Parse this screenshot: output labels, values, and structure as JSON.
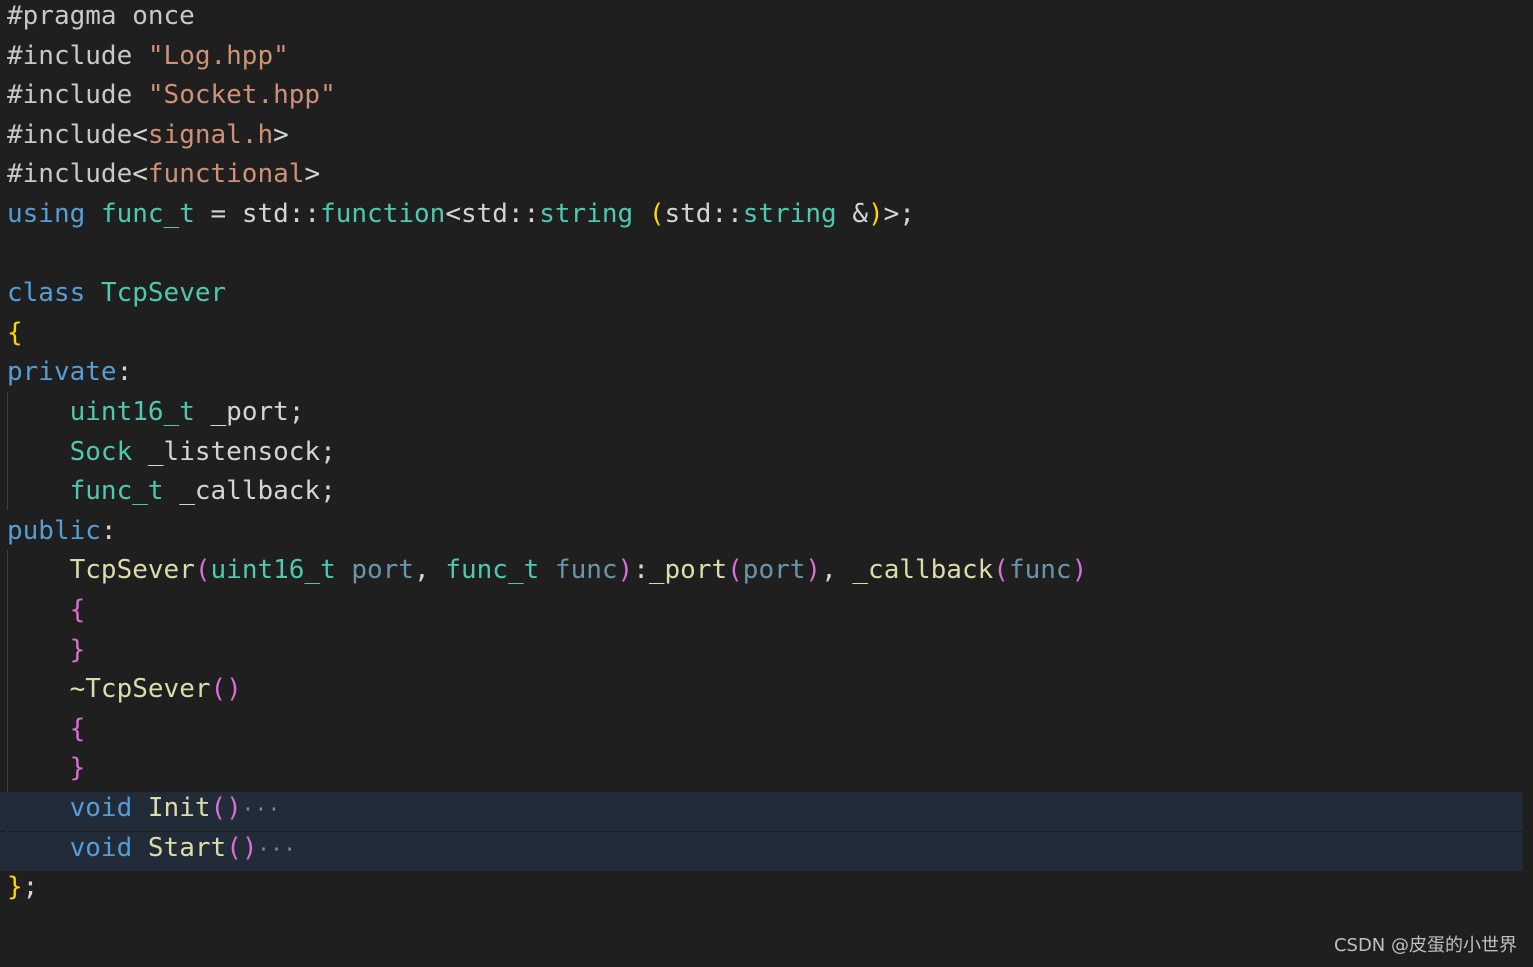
{
  "colors": {
    "background": "#1f1f1f",
    "folded_line_highlight": "#222c39",
    "keyword": "#569cd6",
    "type": "#4ec9b0",
    "function": "#dcdcaa",
    "string": "#ce9178",
    "parameter": "#9cdcfe",
    "bracket_level1": "#ffd700",
    "bracket_level2": "#da70d6",
    "plain": "#d4d4d4"
  },
  "code": {
    "language": "cpp",
    "lines": [
      {
        "folded": false,
        "tokens": [
          {
            "t": "#pragma once",
            "k": "prep"
          }
        ]
      },
      {
        "folded": false,
        "tokens": [
          {
            "t": "#include ",
            "k": "prep"
          },
          {
            "t": "\"Log.hpp\"",
            "k": "string"
          }
        ]
      },
      {
        "folded": false,
        "tokens": [
          {
            "t": "#include ",
            "k": "prep"
          },
          {
            "t": "\"Socket.hpp\"",
            "k": "string"
          }
        ]
      },
      {
        "folded": false,
        "tokens": [
          {
            "t": "#include",
            "k": "prep"
          },
          {
            "t": "<",
            "k": "op"
          },
          {
            "t": "signal.h",
            "k": "string"
          },
          {
            "t": ">",
            "k": "op"
          }
        ]
      },
      {
        "folded": false,
        "tokens": [
          {
            "t": "#include",
            "k": "prep"
          },
          {
            "t": "<",
            "k": "op"
          },
          {
            "t": "functional",
            "k": "string"
          },
          {
            "t": ">",
            "k": "op"
          }
        ]
      },
      {
        "folded": false,
        "tokens": [
          {
            "t": "using",
            "k": "keyword"
          },
          {
            "t": " ",
            "k": "plain"
          },
          {
            "t": "func_t",
            "k": "type"
          },
          {
            "t": " = std::",
            "k": "plain"
          },
          {
            "t": "function",
            "k": "type"
          },
          {
            "t": "<std::",
            "k": "plain"
          },
          {
            "t": "string",
            "k": "type"
          },
          {
            "t": " ",
            "k": "plain"
          },
          {
            "t": "(",
            "k": "brace1"
          },
          {
            "t": "std::",
            "k": "plain"
          },
          {
            "t": "string",
            "k": "type"
          },
          {
            "t": " &",
            "k": "plain"
          },
          {
            "t": ")",
            "k": "brace1"
          },
          {
            "t": ">;",
            "k": "plain"
          }
        ]
      },
      {
        "folded": false,
        "tokens": []
      },
      {
        "folded": false,
        "tokens": [
          {
            "t": "class",
            "k": "keyword"
          },
          {
            "t": " ",
            "k": "plain"
          },
          {
            "t": "TcpSever",
            "k": "type"
          }
        ]
      },
      {
        "folded": false,
        "tokens": [
          {
            "t": "{",
            "k": "brace1"
          }
        ]
      },
      {
        "folded": false,
        "tokens": [
          {
            "t": "private",
            "k": "keyword"
          },
          {
            "t": ":",
            "k": "plain"
          }
        ]
      },
      {
        "folded": false,
        "tokens": [
          {
            "t": "    ",
            "k": "plain"
          },
          {
            "t": "uint16_t",
            "k": "type"
          },
          {
            "t": " _port;",
            "k": "member"
          }
        ]
      },
      {
        "folded": false,
        "tokens": [
          {
            "t": "    ",
            "k": "plain"
          },
          {
            "t": "Sock",
            "k": "type"
          },
          {
            "t": " _listensock;",
            "k": "member"
          }
        ]
      },
      {
        "folded": false,
        "tokens": [
          {
            "t": "    ",
            "k": "plain"
          },
          {
            "t": "func_t",
            "k": "type"
          },
          {
            "t": " _callback;",
            "k": "member"
          }
        ]
      },
      {
        "folded": false,
        "tokens": [
          {
            "t": "public",
            "k": "keyword"
          },
          {
            "t": ":",
            "k": "plain"
          }
        ]
      },
      {
        "folded": false,
        "tokens": [
          {
            "t": "    ",
            "k": "plain"
          },
          {
            "t": "TcpSever",
            "k": "func"
          },
          {
            "t": "(",
            "k": "brace2"
          },
          {
            "t": "uint16_t",
            "k": "type"
          },
          {
            "t": " ",
            "k": "plain"
          },
          {
            "t": "port",
            "k": "param"
          },
          {
            "t": ", ",
            "k": "plain"
          },
          {
            "t": "func_t",
            "k": "type"
          },
          {
            "t": " ",
            "k": "plain"
          },
          {
            "t": "func",
            "k": "param"
          },
          {
            "t": ")",
            "k": "brace2"
          },
          {
            "t": ":",
            "k": "plain"
          },
          {
            "t": "_port",
            "k": "func"
          },
          {
            "t": "(",
            "k": "brace2"
          },
          {
            "t": "port",
            "k": "param"
          },
          {
            "t": ")",
            "k": "brace2"
          },
          {
            "t": ", ",
            "k": "plain"
          },
          {
            "t": "_callback",
            "k": "func"
          },
          {
            "t": "(",
            "k": "brace2"
          },
          {
            "t": "func",
            "k": "param"
          },
          {
            "t": ")",
            "k": "brace2"
          }
        ]
      },
      {
        "folded": false,
        "tokens": [
          {
            "t": "    ",
            "k": "plain"
          },
          {
            "t": "{",
            "k": "brace2"
          }
        ]
      },
      {
        "folded": false,
        "tokens": [
          {
            "t": "    ",
            "k": "plain"
          },
          {
            "t": "}",
            "k": "brace2"
          }
        ]
      },
      {
        "folded": false,
        "tokens": [
          {
            "t": "    ",
            "k": "plain"
          },
          {
            "t": "~TcpSever",
            "k": "func"
          },
          {
            "t": "()",
            "k": "brace2"
          }
        ]
      },
      {
        "folded": false,
        "tokens": [
          {
            "t": "    ",
            "k": "plain"
          },
          {
            "t": "{",
            "k": "brace2"
          }
        ]
      },
      {
        "folded": false,
        "tokens": [
          {
            "t": "    ",
            "k": "plain"
          },
          {
            "t": "}",
            "k": "brace2"
          }
        ]
      },
      {
        "folded": true,
        "tokens": [
          {
            "t": "    ",
            "k": "plain"
          },
          {
            "t": "void",
            "k": "keyword"
          },
          {
            "t": " ",
            "k": "plain"
          },
          {
            "t": "Init",
            "k": "func"
          },
          {
            "t": "()",
            "k": "brace2"
          },
          {
            "t": "···",
            "k": "ellipsis"
          }
        ]
      },
      {
        "folded": true,
        "tokens": [
          {
            "t": "    ",
            "k": "plain"
          },
          {
            "t": "void",
            "k": "keyword"
          },
          {
            "t": " ",
            "k": "plain"
          },
          {
            "t": "Start",
            "k": "func"
          },
          {
            "t": "()",
            "k": "brace2"
          },
          {
            "t": "···",
            "k": "ellipsis"
          }
        ]
      },
      {
        "folded": false,
        "tokens": [
          {
            "t": "}",
            "k": "brace1"
          },
          {
            "t": ";",
            "k": "plain"
          }
        ]
      }
    ]
  },
  "watermark": "CSDN @皮蛋的小世界"
}
